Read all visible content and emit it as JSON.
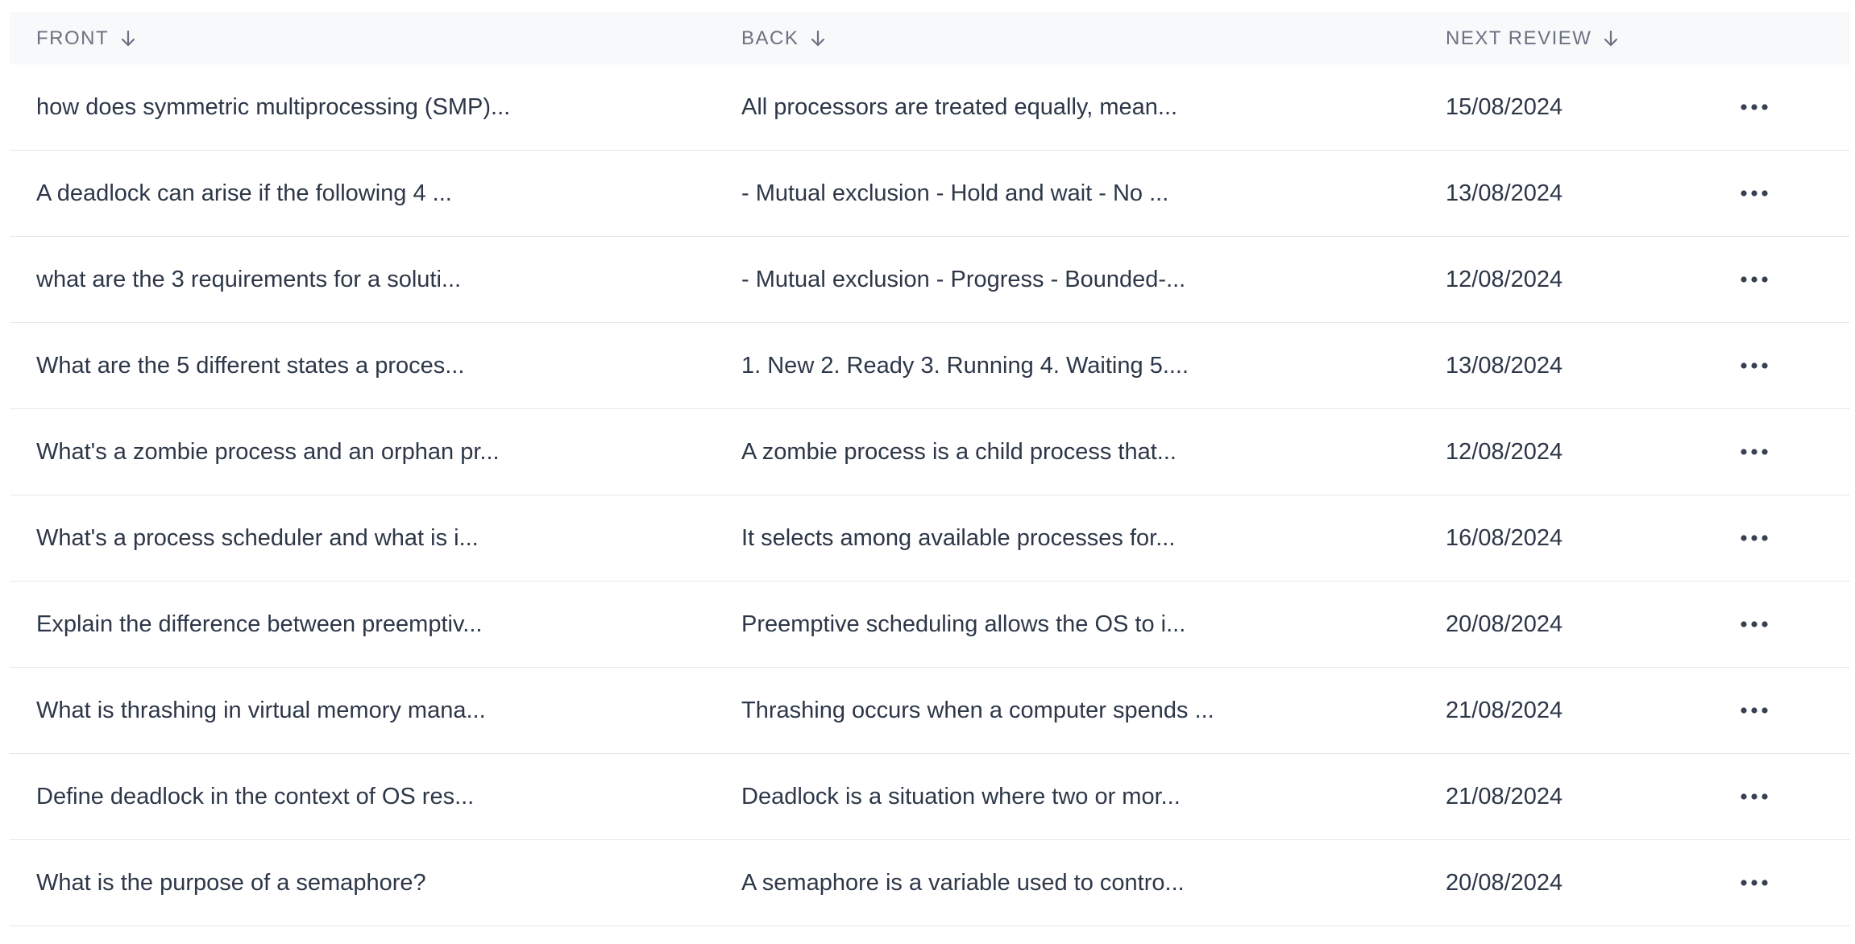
{
  "table": {
    "headers": {
      "front": "FRONT",
      "back": "BACK",
      "next_review": "NEXT REVIEW"
    },
    "rows": [
      {
        "front": "how does symmetric multiprocessing (SMP)...",
        "back": "All processors are treated equally, mean...",
        "next_review": "15/08/2024"
      },
      {
        "front": "A deadlock can arise if the following 4 ...",
        "back": "- Mutual exclusion - Hold and wait - No ...",
        "next_review": "13/08/2024"
      },
      {
        "front": "what are the 3 requirements for a soluti...",
        "back": "- Mutual exclusion - Progress - Bounded-...",
        "next_review": "12/08/2024"
      },
      {
        "front": "What are the 5 different states a proces...",
        "back": "1. New 2. Ready 3. Running 4. Waiting 5....",
        "next_review": "13/08/2024"
      },
      {
        "front": "What's a zombie process and an orphan pr...",
        "back": "A zombie process is a child process that...",
        "next_review": "12/08/2024"
      },
      {
        "front": "What's a process scheduler and what is i...",
        "back": "It selects among available processes for...",
        "next_review": "16/08/2024"
      },
      {
        "front": "Explain the difference between preemptiv...",
        "back": "Preemptive scheduling allows the OS to i...",
        "next_review": "20/08/2024"
      },
      {
        "front": "What is thrashing in virtual memory mana...",
        "back": "Thrashing occurs when a computer spends ...",
        "next_review": "21/08/2024"
      },
      {
        "front": "Define deadlock in the context of OS res...",
        "back": "Deadlock is a situation where two or mor...",
        "next_review": "21/08/2024"
      },
      {
        "front": "What is the purpose of a semaphore?",
        "back": "A semaphore is a variable used to contro...",
        "next_review": "20/08/2024"
      }
    ],
    "row_action_icon": "more-horizontal-icon",
    "sort_icon": "arrow-down-icon"
  }
}
